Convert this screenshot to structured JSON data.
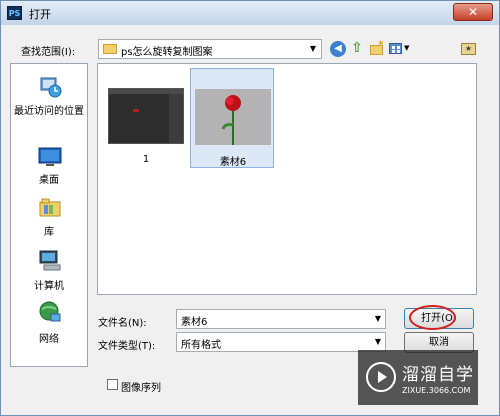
{
  "window": {
    "title": "打开",
    "app_icon": "PS"
  },
  "toolbar": {
    "look_in_label": "查找范围(I):",
    "look_in_value": "ps怎么旋转复制图案",
    "icons": [
      "back-icon",
      "up-folder-icon",
      "new-folder-icon",
      "views-menu-icon",
      "favorites-icon"
    ]
  },
  "places": [
    {
      "label": "最近访问的位置",
      "icon": "recent-places-icon"
    },
    {
      "label": "桌面",
      "icon": "desktop-icon"
    },
    {
      "label": "库",
      "icon": "libraries-icon"
    },
    {
      "label": "计算机",
      "icon": "computer-icon"
    },
    {
      "label": "网络",
      "icon": "network-icon"
    }
  ],
  "files": [
    {
      "name": "1",
      "selected": false
    },
    {
      "name": "素材6",
      "selected": true
    }
  ],
  "bottom": {
    "filename_label": "文件名(N):",
    "filename_value": "素材6",
    "filetype_label": "文件类型(T):",
    "filetype_value": "所有格式",
    "open_label": "打开(O)",
    "cancel_label": "取消",
    "sequence_label": "图像序列"
  },
  "watermark": {
    "name": "溜溜自学",
    "url": "ZIXUE.3066.COM"
  },
  "colors": {
    "highlight_ring": "#d41f1f",
    "selection": "#dde8f6",
    "title_bar": "#c4d5e8"
  }
}
